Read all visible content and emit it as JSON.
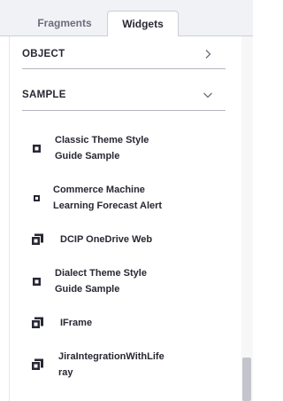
{
  "tabs": [
    {
      "label": "Fragments",
      "active": false
    },
    {
      "label": "Widgets",
      "active": true
    }
  ],
  "sections": [
    {
      "label": "OBJECT",
      "expanded": false,
      "icon": "chevron-right-icon"
    },
    {
      "label": "SAMPLE",
      "expanded": true,
      "icon": "chevron-down-icon"
    }
  ],
  "widgets": [
    {
      "line1": "Classic Theme Style",
      "line2": "Guide Sample",
      "icon": "widget-single-icon"
    },
    {
      "line1": "Commerce Machine",
      "line2": "Learning Forecast Alert",
      "icon": "widget-single-small-icon"
    },
    {
      "line1": "DCIP OneDrive Web",
      "line2": "",
      "icon": "widget-instanceable-icon"
    },
    {
      "line1": "Dialect Theme Style",
      "line2": "Guide Sample",
      "icon": "widget-single-icon"
    },
    {
      "line1": "IFrame",
      "line2": "",
      "icon": "widget-instanceable-icon"
    },
    {
      "line1": "JiraIntegrationWithLife",
      "line2": "ray",
      "icon": "widget-instanceable-icon"
    }
  ],
  "colors": {
    "text": "#272833",
    "tab_inactive": "#6b6c7e",
    "tabbar_bg": "#f1f2f5",
    "divider": "#b5b6c2"
  }
}
